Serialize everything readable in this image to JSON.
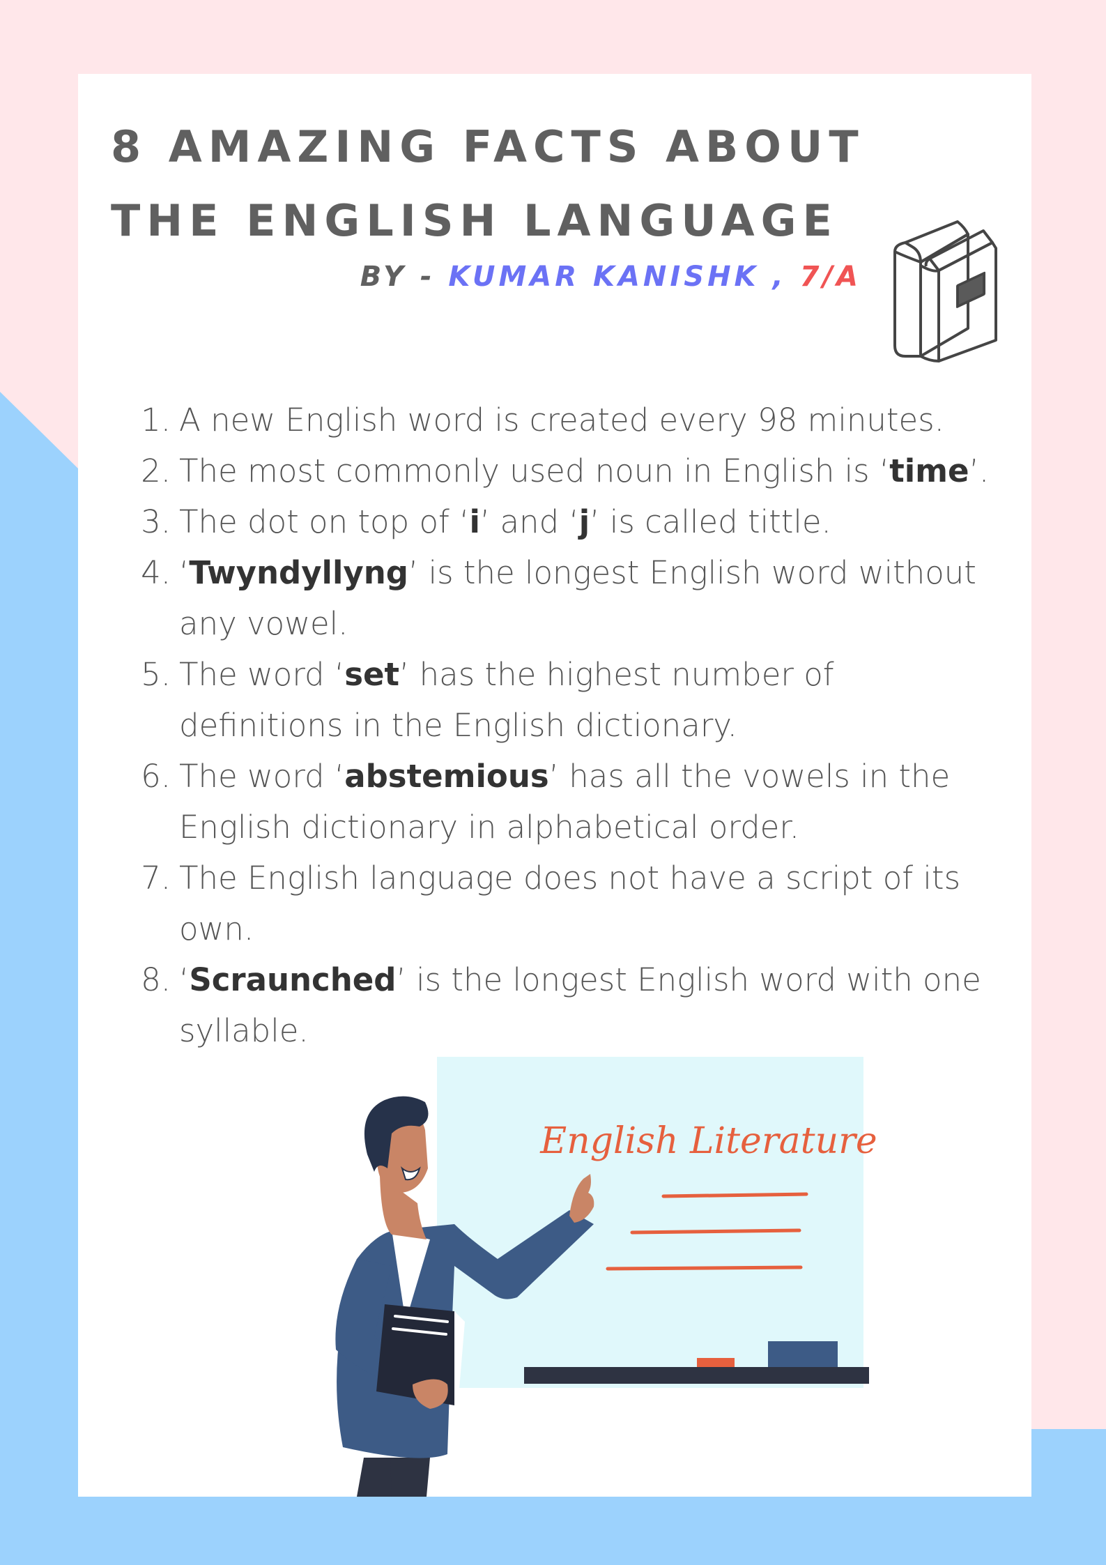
{
  "colors": {
    "accent_name": "#6b72f5",
    "accent_class": "#f05454",
    "bg_pink": "#ffe7ea",
    "bg_blue": "#9cd2fd",
    "text": "#555555",
    "board": "#e0f8fb",
    "board_lines": "#e6603e"
  },
  "title": {
    "line1": "8 AMAZING FACTS ABOUT",
    "line2": "THE ENGLISH LANGUAGE"
  },
  "byline": {
    "prefix": "BY - ",
    "name": "KUMAR KANISHK , ",
    "class": "7/A"
  },
  "facts": [
    {
      "num": "1.",
      "before": " A new English word is created every 98 minutes.",
      "b1": "",
      "mid": "",
      "b2": "",
      "after": ""
    },
    {
      "num": "2.",
      "before": " The most commonly used noun in English is ‘",
      "b1": "time",
      "mid": "’.",
      "b2": "",
      "after": ""
    },
    {
      "num": "3.",
      "before": " The dot on top of ‘",
      "b1": "i",
      "mid": "’ and ‘",
      "b2": "j",
      "after": "’ is called tittle."
    },
    {
      "num": "4.",
      "before": " ‘",
      "b1": "Twyndyllyng",
      "mid": "’ is the longest English word without any vowel.",
      "b2": "",
      "after": ""
    },
    {
      "num": "5.",
      "before": " The word ‘",
      "b1": "set",
      "mid": "’ has the highest number of definitions in the English dictionary.",
      "b2": "",
      "after": ""
    },
    {
      "num": "6.",
      "before": " The word ‘",
      "b1": "abstemious",
      "mid": "’ has all the vowels in the English dictionary in alphabetical order.",
      "b2": "",
      "after": ""
    },
    {
      "num": "7.",
      "before": " The English language does not have a script of its own.",
      "b1": "",
      "mid": "",
      "b2": "",
      "after": ""
    },
    {
      "num": "8.",
      "before": " ‘",
      "b1": "Scraunched",
      "mid": "’ is the longest English word with one syllable.",
      "b2": "",
      "after": ""
    }
  ],
  "illustration": {
    "board_text": "English Literature",
    "icons": [
      "books-icon",
      "teacher-illustration"
    ]
  }
}
